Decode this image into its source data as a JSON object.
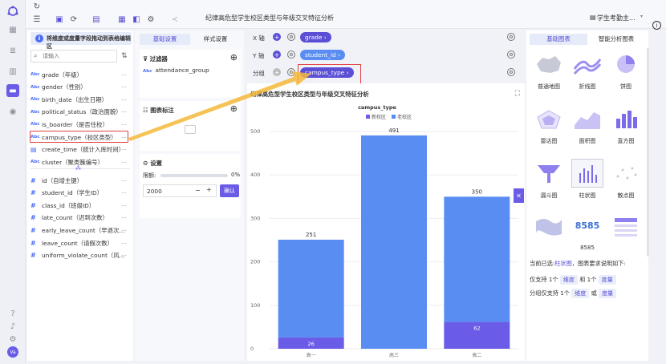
{
  "toolbar": {
    "report_title": "纪律高危型学生校区类型与年级交叉特征分析",
    "user_name": "学生考勤主..."
  },
  "rail": {
    "avatar": "Va"
  },
  "field_panel": {
    "hint": "将维度或度量字段拖动到表格编辑区",
    "search_placeholder": "请输入",
    "dimensions": [
      {
        "type": "Abc",
        "label": "grade（年级）"
      },
      {
        "type": "Abc",
        "label": "gender（性别）"
      },
      {
        "type": "Abc",
        "label": "birth_date（出生日期）"
      },
      {
        "type": "Abc",
        "label": "political_status（政治面貌）"
      },
      {
        "type": "Abc",
        "label": "is_boarder（是否住校）"
      },
      {
        "type": "Abc",
        "label": "campus_type（校区类型）"
      },
      {
        "type": "date",
        "label": "create_time（统计入库时间）"
      },
      {
        "type": "Abc",
        "label": "cluster（聚类簇编号）"
      }
    ],
    "measures": [
      {
        "label": "id（自增主键）"
      },
      {
        "label": "student_id（学生ID）"
      },
      {
        "label": "class_id（班级ID）"
      },
      {
        "label": "late_count（迟到次数）"
      },
      {
        "label": "early_leave_count（早退次..."
      },
      {
        "label": "leave_count（请假次数）"
      },
      {
        "label": "uniform_violate_count（风..."
      }
    ]
  },
  "config_panel": {
    "tab_basic": "基础设置",
    "tab_style": "样式设置",
    "filter_title": "过滤器",
    "filter_item_type": "Abc",
    "filter_item": "attendance_group",
    "annotation_title": "图表标注",
    "settings_title": "设置",
    "limit_label": "限额:",
    "limit_percent": "0%",
    "limit_value": "2000",
    "confirm": "确认"
  },
  "axes": {
    "x_label": "X 轴",
    "x_field": "grade",
    "y_label": "Y 轴",
    "y_field": "student_id",
    "group_label": "分组",
    "group_field": "campus_type"
  },
  "chart_data": {
    "type": "bar",
    "title": "纪律高危型学生校区类型与年级交叉特征分析",
    "legend_title": "campus_type",
    "categories": [
      "高一",
      "高三",
      "高二"
    ],
    "series": [
      {
        "name": "新校区",
        "values": [
          26,
          0,
          62
        ],
        "color": "#6b5ce7"
      },
      {
        "name": "老校区",
        "values": [
          225,
          491,
          288
        ],
        "color": "#5a8df2"
      }
    ],
    "totals": [
      251,
      491,
      350
    ],
    "bottom_labels": [
      "26",
      "",
      "62"
    ],
    "ylim": [
      0,
      500
    ],
    "yticks": [
      0,
      100,
      200,
      300,
      400,
      500
    ],
    "grid": true,
    "legend_position": "top"
  },
  "right_panel": {
    "tab_basic": "基础图表",
    "tab_smart": "智能分析图表",
    "chart_types": [
      "普通地图",
      "折线图",
      "饼图",
      "雷达图",
      "面积图",
      "直方图",
      "漏斗图",
      "柱状图",
      "散点图",
      "",
      "8585",
      ""
    ],
    "current_prefix": "当前已选:",
    "current_chart": "柱状图",
    "current_suffix": "，图表要求说明如下:",
    "req1_prefix": "仅支持 1个",
    "req1_tag1": "维度",
    "req1_mid": "和 1个",
    "req1_tag2": "度量",
    "req2_prefix": "分组仅支持 1个",
    "req2_tag1": "维度",
    "req2_mid": "或",
    "req2_tag2": "度量"
  }
}
